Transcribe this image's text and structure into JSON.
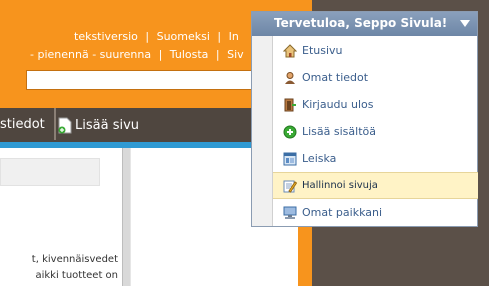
{
  "topnav": {
    "row1": [
      "tekstiversio",
      "Suomeksi",
      "In"
    ],
    "row2": [
      "- pienennä - suurenna",
      "Tulosta",
      "Siv"
    ]
  },
  "toolbar": {
    "current_tab": "stiedot",
    "add_page_label": "Lisää sivu"
  },
  "content": {
    "text_line1": "t, kivennäisvedet",
    "text_line2": "aikki tuotteet on"
  },
  "menu": {
    "title": "Tervetuloa, Seppo Sivula!",
    "items": [
      {
        "label": "Etusivu",
        "icon": "home-icon"
      },
      {
        "label": "Omat tiedot",
        "icon": "user-icon"
      },
      {
        "label": "Kirjaudu ulos",
        "icon": "logout-icon"
      },
      {
        "label": "Lisää sisältöä",
        "icon": "add-icon"
      },
      {
        "label": "Leiska",
        "icon": "layout-icon"
      },
      {
        "label": "Hallinnoi sivuja",
        "icon": "edit-pages-icon"
      },
      {
        "label": "Omat paikkani",
        "icon": "computer-icon"
      }
    ]
  },
  "colors": {
    "header_orange": "#f7941d",
    "toolbar_dark": "#4f463f",
    "accent_blue": "#2f9ad3",
    "menu_header": "#7a92b0",
    "menu_selected": "#fff3c6"
  }
}
